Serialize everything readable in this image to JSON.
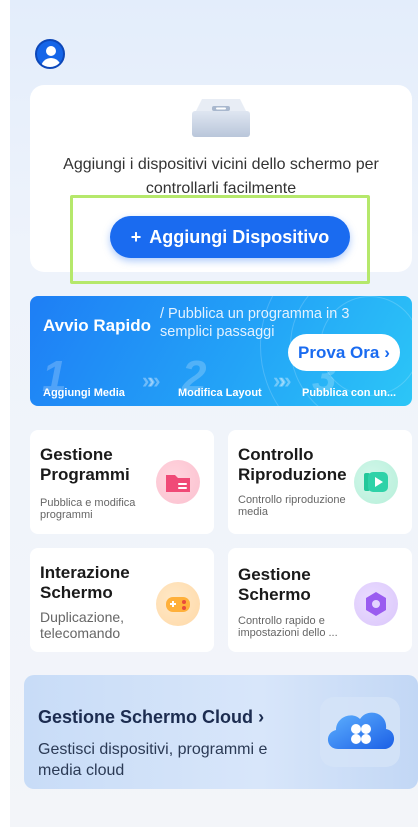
{
  "device_section": {
    "message": "Aggiungi i dispositivi vicini dello schermo per controllarli facilmente",
    "add_button_label": "Aggiungi Dispositivo",
    "add_button_icon": "+"
  },
  "quick_start": {
    "title": "Avvio Rapido",
    "subtitle": "/ Pubblica un programma in 3 semplici passaggi",
    "cta_label": "Prova Ora",
    "cta_arrow": "›",
    "steps": [
      {
        "number": "1",
        "label": "Aggiungi Media"
      },
      {
        "number": "2",
        "label": "Modifica Layout"
      },
      {
        "number": "3",
        "label": "Pubblica con un..."
      }
    ]
  },
  "features": [
    {
      "title": "Gestione Programmi",
      "description": "Pubblica e modifica programmi",
      "icon": "folder-icon"
    },
    {
      "title": "Controllo Riproduzione",
      "description": "Controllo riproduzione media",
      "icon": "play-icon"
    },
    {
      "title": "Interazione Schermo",
      "description": "Duplicazione, telecomando",
      "icon": "gamepad-icon"
    },
    {
      "title": "Gestione Schermo",
      "description": "Controllo rapido e impostazioni dello ...",
      "icon": "hexagon-nut-icon"
    }
  ],
  "cloud": {
    "title": "Gestione Schermo Cloud",
    "title_arrow": "›",
    "description": "Gestisci dispositivi, programmi e media cloud"
  },
  "colors": {
    "primary": "#1a6bf0",
    "highlight": "#b5e86b"
  }
}
